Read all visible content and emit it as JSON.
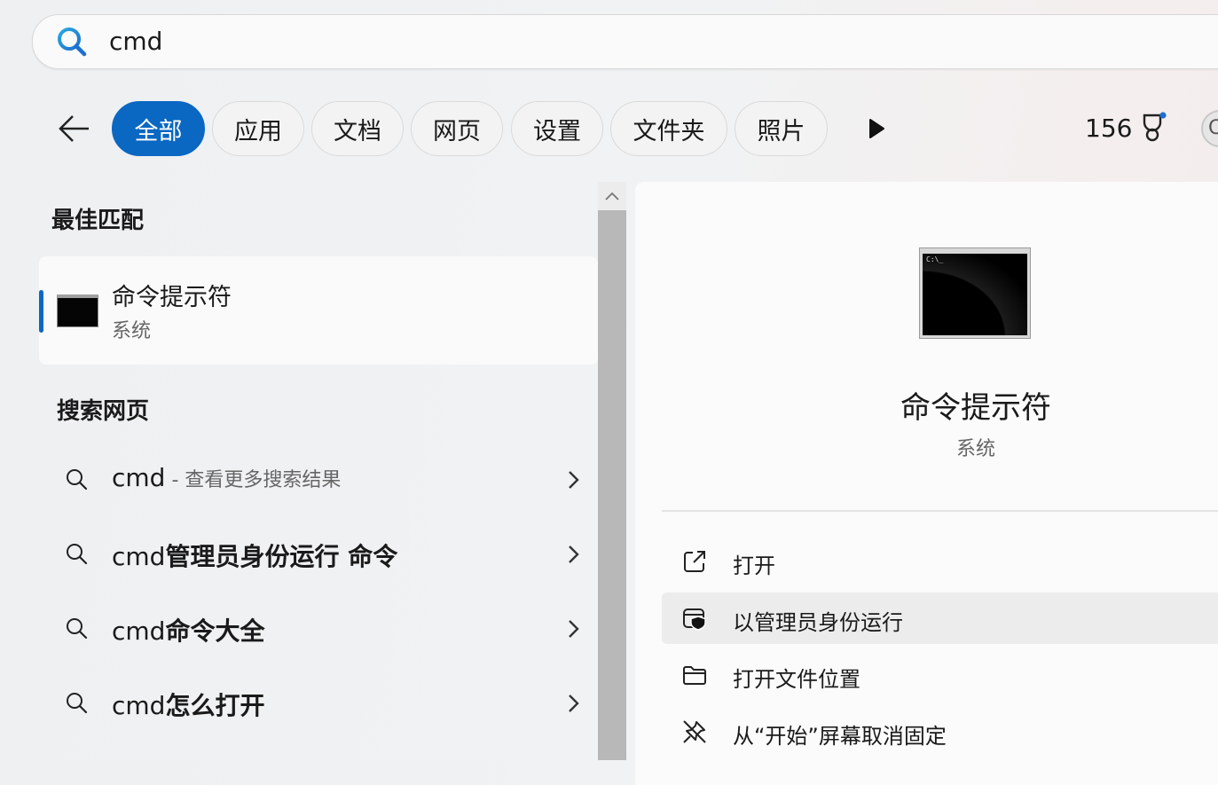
{
  "search": {
    "query": "cmd"
  },
  "filters": {
    "items": [
      {
        "label": "全部",
        "active": true
      },
      {
        "label": "应用",
        "active": false
      },
      {
        "label": "文档",
        "active": false
      },
      {
        "label": "网页",
        "active": false
      },
      {
        "label": "设置",
        "active": false
      },
      {
        "label": "文件夹",
        "active": false
      },
      {
        "label": "照片",
        "active": false
      }
    ],
    "points": "156",
    "avatar_initial": "C"
  },
  "best_match": {
    "heading": "最佳匹配",
    "name": "命令提示符",
    "type": "系统"
  },
  "web_search": {
    "heading": "搜索网页",
    "items": [
      {
        "prefix": "cmd",
        "bold": "",
        "hint": " - 查看更多搜索结果"
      },
      {
        "prefix": "cmd",
        "bold": "管理员身份运行 命令",
        "hint": ""
      },
      {
        "prefix": "cmd",
        "bold": "命令大全",
        "hint": ""
      },
      {
        "prefix": "cmd",
        "bold": "怎么打开",
        "hint": ""
      }
    ]
  },
  "preview": {
    "thumb_text": "C:\\_",
    "name": "命令提示符",
    "type": "系统",
    "actions": [
      {
        "label": "打开",
        "icon": "open-external-icon"
      },
      {
        "label": "以管理员身份运行",
        "icon": "admin-shield-icon"
      },
      {
        "label": "打开文件位置",
        "icon": "folder-icon"
      },
      {
        "label": "从“开始”屏幕取消固定",
        "icon": "unpin-icon"
      }
    ]
  },
  "colors": {
    "accent": "#0a67c2"
  }
}
